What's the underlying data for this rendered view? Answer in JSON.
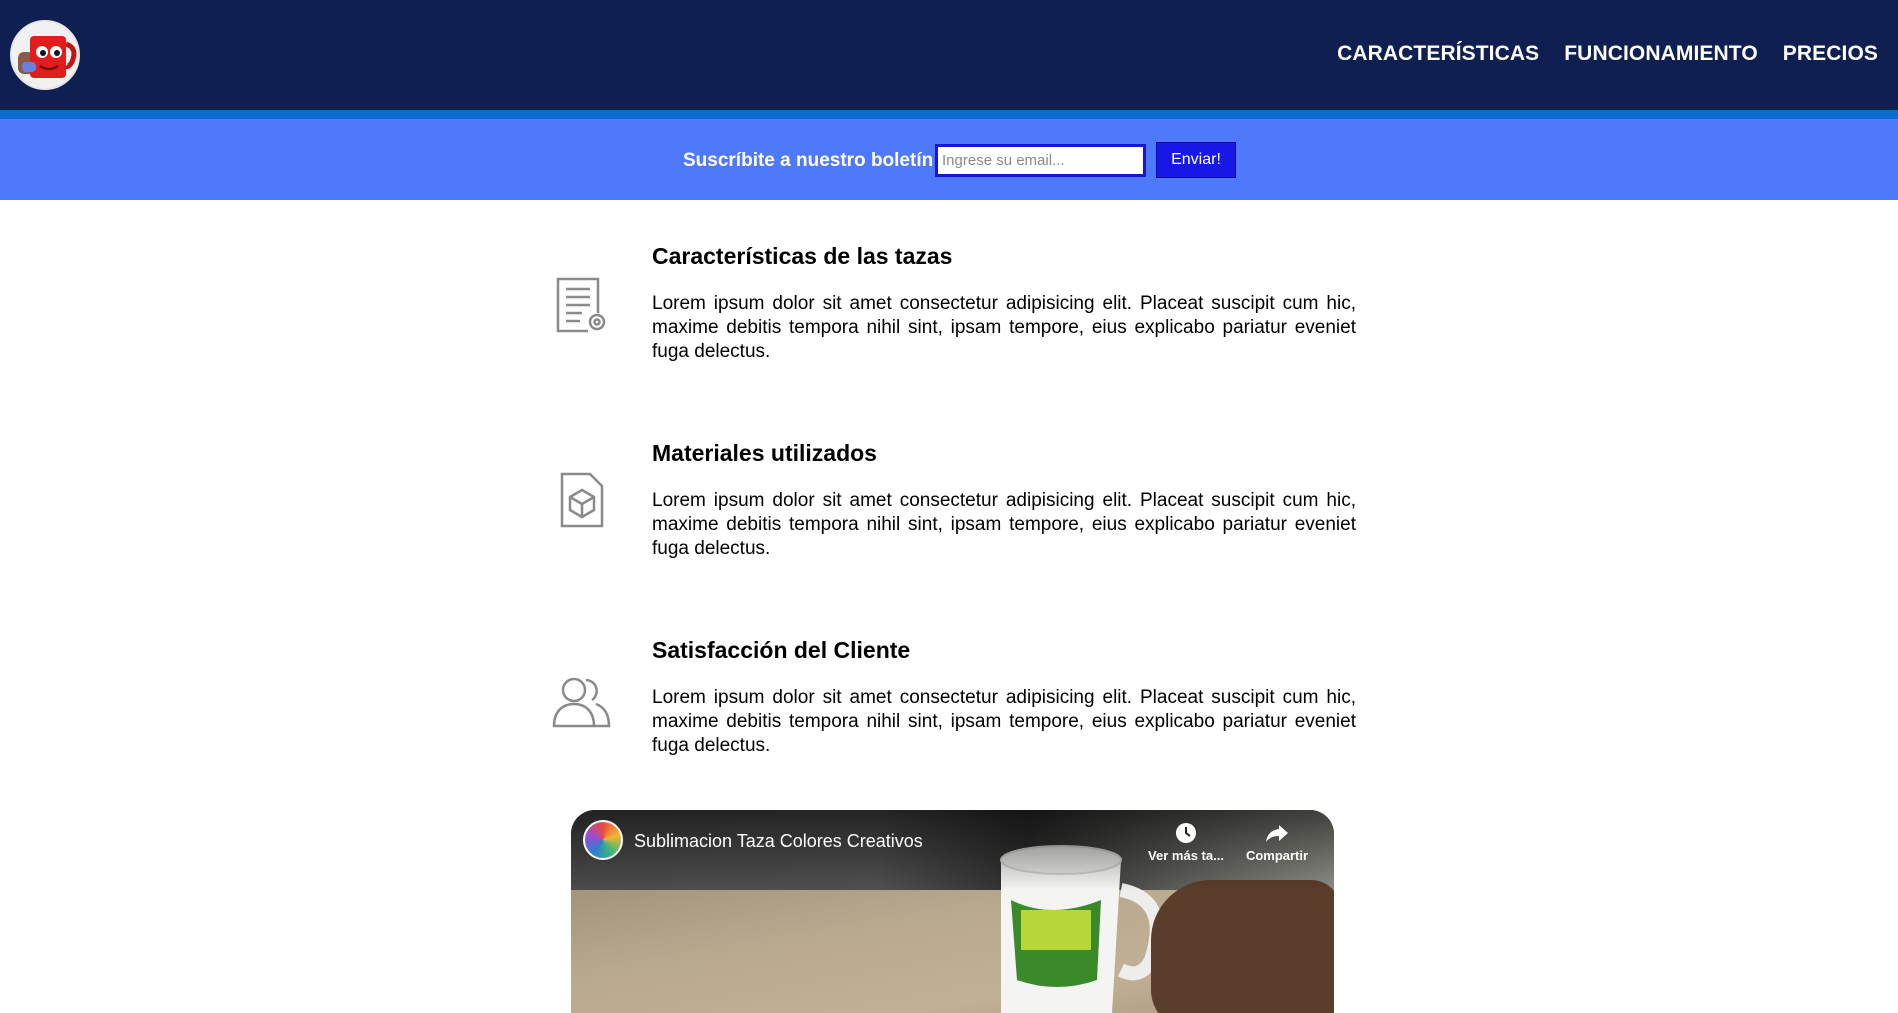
{
  "header": {
    "logo_alt": "mug mascot logo",
    "nav": [
      {
        "label": "CARACTERÍSTICAS"
      },
      {
        "label": "FUNCIONAMIENTO"
      },
      {
        "label": "PRECIOS"
      }
    ]
  },
  "newsletter": {
    "label": "Suscríbite a nuestro boletín",
    "email_placeholder": "Ingrese su email...",
    "submit_label": "Enviar!"
  },
  "features": [
    {
      "icon": "certificate-document-icon",
      "title": "Características de las tazas",
      "text": "Lorem ipsum dolor sit amet consectetur adipisicing elit. Placeat suscipit cum hic, maxime debitis tempora nihil sint, ipsam tempore, eius explicabo pariatur eveniet fuga delectus."
    },
    {
      "icon": "box-document-icon",
      "title": "Materiales utilizados",
      "text": "Lorem ipsum dolor sit amet consectetur adipisicing elit. Placeat suscipit cum hic, maxime debitis tempora nihil sint, ipsam tempore, eius explicabo pariatur eveniet fuga delectus."
    },
    {
      "icon": "users-icon",
      "title": "Satisfacción del Cliente",
      "text": "Lorem ipsum dolor sit amet consectetur adipisicing elit. Placeat suscipit cum hic, maxime debitis tempora nihil sint, ipsam tempore, eius explicabo pariatur eveniet fuga delectus."
    }
  ],
  "video": {
    "title": "Sublimacion Taza Colores Creativos",
    "watch_later_label": "Ver más ta...",
    "share_label": "Compartir"
  },
  "colors": {
    "header_bg": "#0f1f52",
    "stripe": "#0d6bd1",
    "newsletter_bg": "#4f79fb",
    "button_bg": "#1717e6"
  }
}
